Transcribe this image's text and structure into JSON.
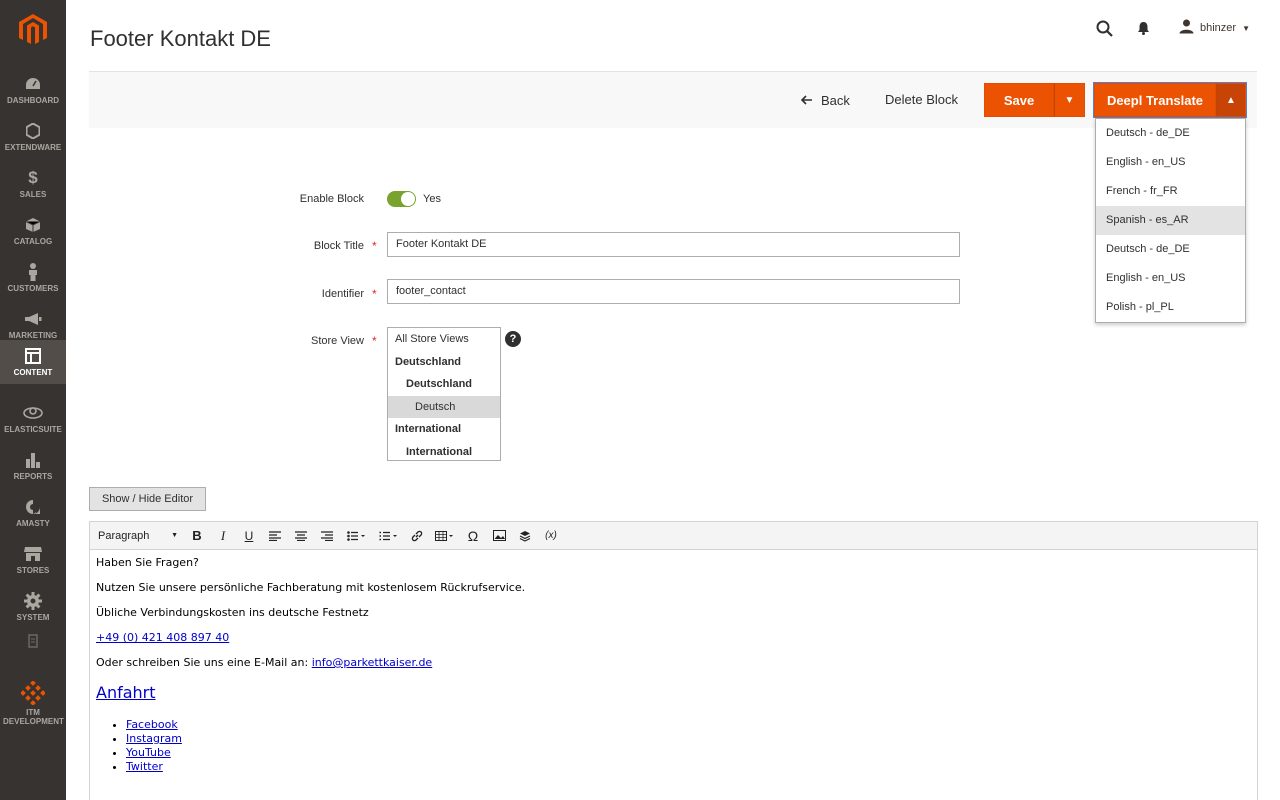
{
  "sidebar": {
    "items": [
      {
        "label": "DASHBOARD",
        "icon": "dashboard-icon"
      },
      {
        "label": "EXTENDWARE",
        "icon": "hexagon-icon"
      },
      {
        "label": "SALES",
        "icon": "dollar-icon"
      },
      {
        "label": "CATALOG",
        "icon": "box-icon"
      },
      {
        "label": "CUSTOMERS",
        "icon": "person-icon"
      },
      {
        "label": "MARKETING",
        "icon": "megaphone-icon"
      },
      {
        "label": "CONTENT",
        "icon": "layout-icon"
      },
      {
        "label": "ELASTICSUITE",
        "icon": "elasticsuite-icon"
      },
      {
        "label": "REPORTS",
        "icon": "bar-chart-icon"
      },
      {
        "label": "AMASTY",
        "icon": "amasty-icon"
      },
      {
        "label": "STORES",
        "icon": "store-icon"
      },
      {
        "label": "SYSTEM",
        "icon": "gear-icon"
      },
      {
        "label": "ITM DEVELOPMENT",
        "icon": "itm-icon"
      }
    ]
  },
  "header": {
    "title": "Footer Kontakt DE",
    "username": "bhinzer"
  },
  "actions": {
    "back": "Back",
    "delete": "Delete Block",
    "save": "Save",
    "deepl": "Deepl Translate"
  },
  "deepl_menu": {
    "options": [
      "Deutsch - de_DE",
      "English - en_US",
      "French - fr_FR",
      "Spanish - es_AR",
      "Deutsch - de_DE",
      "English - en_US",
      "Polish - pl_PL"
    ],
    "highlighted": "Spanish - es_AR"
  },
  "form": {
    "enable_label": "Enable Block",
    "enable_value": "Yes",
    "title_label": "Block Title",
    "title_value": "Footer Kontakt DE",
    "identifier_label": "Identifier",
    "identifier_value": "footer_contact",
    "store_label": "Store View",
    "store_options": [
      "All Store Views",
      "Deutschland",
      "Deutschland",
      "Deutsch",
      "International",
      "International"
    ],
    "help": "?"
  },
  "editor": {
    "show_hide": "Show / Hide Editor",
    "format": "Paragraph",
    "lines": [
      "Haben Sie Fragen?",
      "Nutzen Sie unsere persönliche Fachberatung mit kostenlosem Rückrufservice.",
      "Übliche Verbindungskosten ins deutsche Festnetz"
    ],
    "phone": "+49 (0) 421 408 897 40",
    "email_prefix": "Oder schreiben Sie uns eine E-Mail an: ",
    "email": "info@parkettkaiser.de",
    "heading": "Anfahrt",
    "links": [
      "Facebook",
      "Instagram",
      "YouTube",
      "Twitter"
    ]
  }
}
